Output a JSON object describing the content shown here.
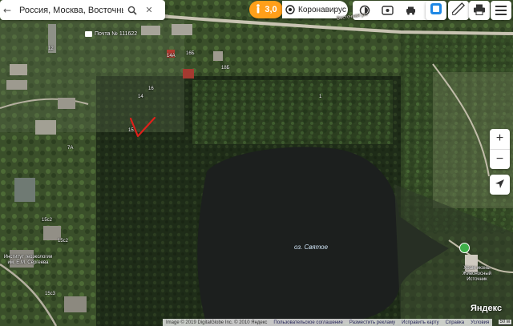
{
  "search": {
    "value": "Россия, Москва, Восточный адми"
  },
  "toolbar": {
    "traffic_level": "3,0",
    "corona_label": "Коронавирус",
    "layer_icons": [
      "traffic-layer-icon",
      "panorama-layer-icon",
      "car-layer-icon",
      "transport-layer-icon",
      "selected-layer-icon"
    ],
    "ruler_icon": "ruler-icon",
    "print_icon": "print-icon",
    "menu_icon": "menu-icon",
    "accent": "#ff9f1a",
    "active_layer_color": "#1e88e5"
  },
  "map": {
    "lake_label": "оз. Святое",
    "post_office_label": "Почта № 111622",
    "road_label": "Восточная ул.",
    "house_numbers": [
      "12",
      "14А",
      "16Б",
      "18Б",
      "14",
      "16",
      "15",
      "7А",
      "15с2",
      "15с2",
      "15с3",
      "1"
    ],
    "poi_label": "Институт геоэкологии им. Е.М. Сергеева",
    "church_label": "Храм иконы Живоносный Источник",
    "zoom_in": "+",
    "zoom_out": "−"
  },
  "footer": {
    "copyright": "Image © 2019 DigitalGlobe Inc. © 2010 Яндекс",
    "links": [
      "Пользовательское соглашение",
      "Разместить рекламу",
      "Исправить карту",
      "Справка",
      "Условия"
    ]
  },
  "scale_label": "50 м",
  "logo": "Яндекс"
}
